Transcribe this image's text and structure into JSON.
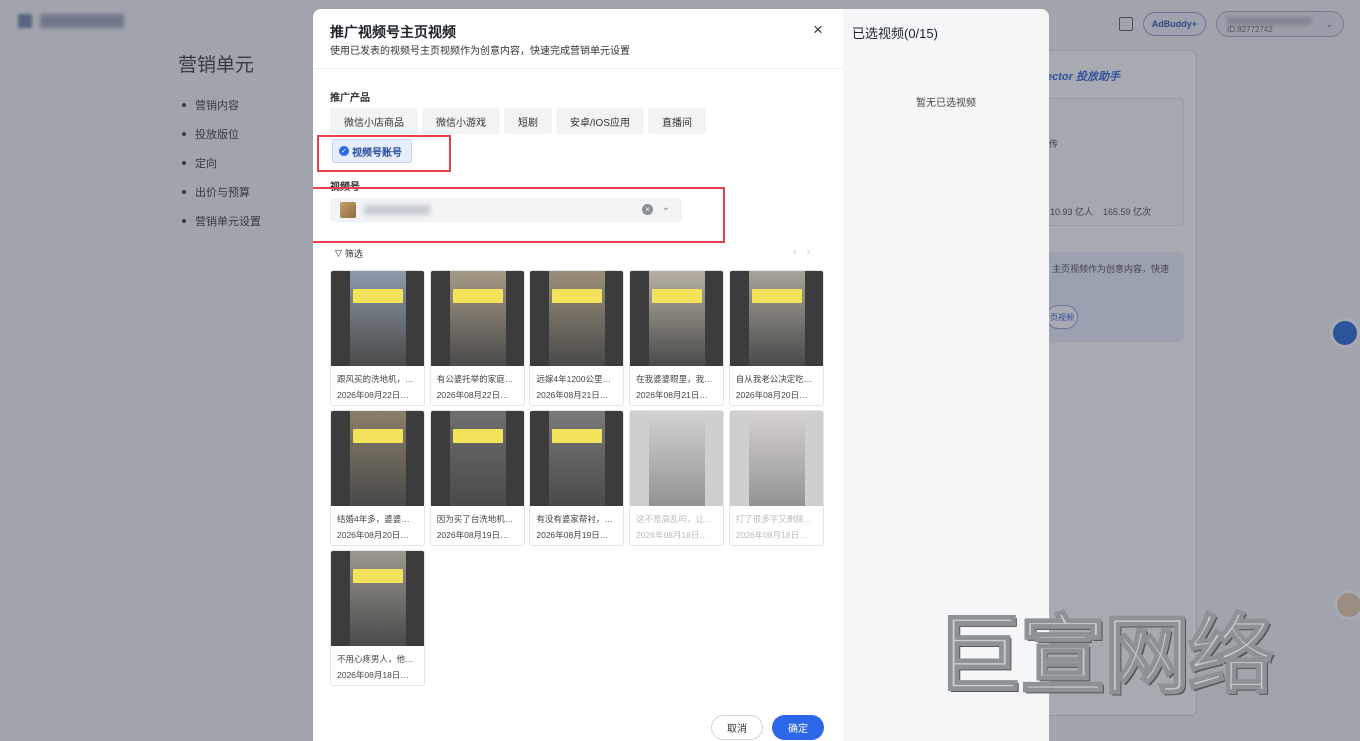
{
  "background": {
    "page_title": "营销单元",
    "nav_items": [
      "营销内容",
      "投放版位",
      "定向",
      "出价与预算",
      "营销单元设置"
    ],
    "adbuddy_label": "AdBuddy+",
    "account_id": "ID:82772742",
    "assistant_title": "ector 投放助手",
    "card_text_1": "传",
    "stat_1": "10.93 亿人",
    "stat_2": "165.59 亿次",
    "blue_card_text": "主页视频作为创意内容，快速",
    "blue_card_button": "页视频"
  },
  "modal": {
    "title": "推广视频号主页视频",
    "subtitle": "使用已发表的视频号主页视频作为创意内容，快速完成营销单元设置",
    "close_icon": "×",
    "product_label": "推广产品",
    "product_tabs": [
      "微信小店商品",
      "微信小游戏",
      "短剧",
      "安卓/IOS应用",
      "直播间"
    ],
    "active_tab": "视频号账号",
    "channel_label": "视频号",
    "filter_label": "筛选",
    "videos": [
      {
        "title": "跟风买的洗地机，…",
        "date": "2026年08月22日…",
        "dim": false
      },
      {
        "title": "有公婆托举的家庭…",
        "date": "2026年08月22日…",
        "dim": false
      },
      {
        "title": "远嫁4年1200公里…",
        "date": "2026年08月21日…",
        "dim": false
      },
      {
        "title": "在我婆婆眼里，我…",
        "date": "2026年08月21日…",
        "dim": false
      },
      {
        "title": "自从我老公决定吃…",
        "date": "2026年08月20日…",
        "dim": false
      },
      {
        "title": "结婚4年多，婆婆…",
        "date": "2026年08月20日…",
        "dim": false
      },
      {
        "title": "因为买了台洗地机…",
        "date": "2026年08月19日…",
        "dim": false
      },
      {
        "title": "有没有婆家帮衬，…",
        "date": "2026年08月19日…",
        "dim": false
      },
      {
        "title": "这不是高乱吗，让…",
        "date": "2026年08月18日…",
        "dim": true
      },
      {
        "title": "打了很多字又删除…",
        "date": "2026年08月18日…",
        "dim": true
      },
      {
        "title": "不用心疼男人，他…",
        "date": "2026年08月18日…",
        "dim": false
      }
    ],
    "cancel_label": "取消",
    "confirm_label": "确定"
  },
  "selected_panel": {
    "title": "已选视频(0/15)",
    "empty_text": "暂无已选视频"
  },
  "watermark": "巨宣网络",
  "colors": {
    "primary": "#2d66e8",
    "highlight_box": "#e8414b",
    "active_tab_bg": "#e6edfd"
  }
}
